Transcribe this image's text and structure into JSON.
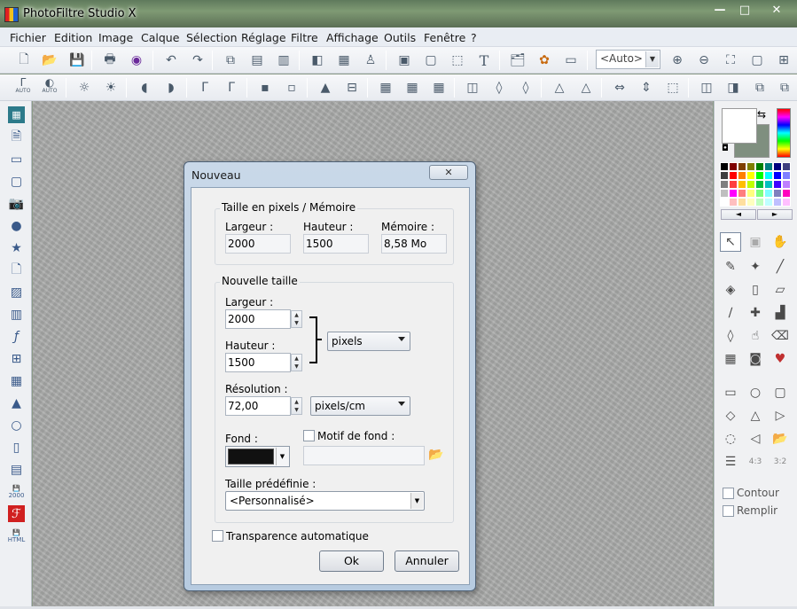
{
  "app": {
    "title": "PhotoFiltre Studio X"
  },
  "window_controls": {
    "minimize": "—",
    "maximize": "□",
    "close": "✕"
  },
  "menu": [
    "Fichier",
    "Edition",
    "Image",
    "Calque",
    "Sélection",
    "Réglage",
    "Filtre",
    "Affichage",
    "Outils",
    "Fenêtre",
    "?"
  ],
  "toolbar": {
    "zoom_value": "<Auto>"
  },
  "toolbar2": {
    "auto_label_1": "AUTO",
    "auto_label_2": "AUTO"
  },
  "left_tools": {
    "export_2000_label": "2000",
    "export_html_label": "HTML"
  },
  "right_panel": {
    "ratio_43": "4:3",
    "ratio_32": "3:2",
    "contour_label": "Contour",
    "remplir_label": "Remplir",
    "primary_color": "#ffffff",
    "secondary_color": "#7f8f7f",
    "palette": [
      "#000000",
      "#7f0000",
      "#7f3f00",
      "#7f7f00",
      "#007f00",
      "#007f7f",
      "#00007f",
      "#3f3f7f",
      "#3f3f3f",
      "#ff0000",
      "#ff7f00",
      "#ffff00",
      "#00ff00",
      "#00ffff",
      "#0000ff",
      "#7f7fff",
      "#7f7f7f",
      "#ff3f3f",
      "#ffbf00",
      "#bfff00",
      "#00bf3f",
      "#00bfbf",
      "#3f00ff",
      "#bf7fff",
      "#bfbfbf",
      "#ff00ff",
      "#ff7f7f",
      "#ffff7f",
      "#7fff7f",
      "#7fffff",
      "#7f7fbf",
      "#ff00bf",
      "#ffffff",
      "#ffbfbf",
      "#ffdf9f",
      "#ffffbf",
      "#bfffbf",
      "#bfffff",
      "#bfbfff",
      "#ffbfff"
    ]
  },
  "dialog": {
    "title": "Nouveau",
    "close": "✕",
    "group_memory": {
      "label": "Taille en pixels / Mémoire",
      "width_label": "Largeur :",
      "width_value": "2000",
      "height_label": "Hauteur :",
      "height_value": "1500",
      "memory_label": "Mémoire :",
      "memory_value": "8,58 Mo"
    },
    "group_new": {
      "label": "Nouvelle taille",
      "width_label": "Largeur :",
      "width_value": "2000",
      "height_label": "Hauteur :",
      "height_value": "1500",
      "unit": "pixels",
      "resolution_label": "Résolution :",
      "resolution_value": "72,00",
      "resolution_unit": "pixels/cm",
      "fond_label": "Fond :",
      "fond_color": "#111111",
      "motif_label": "Motif de fond :",
      "preset_label": "Taille prédéfinie :",
      "preset_value": "<Personnalisé>"
    },
    "transparence_label": "Transparence automatique",
    "ok": "Ok",
    "cancel": "Annuler"
  }
}
